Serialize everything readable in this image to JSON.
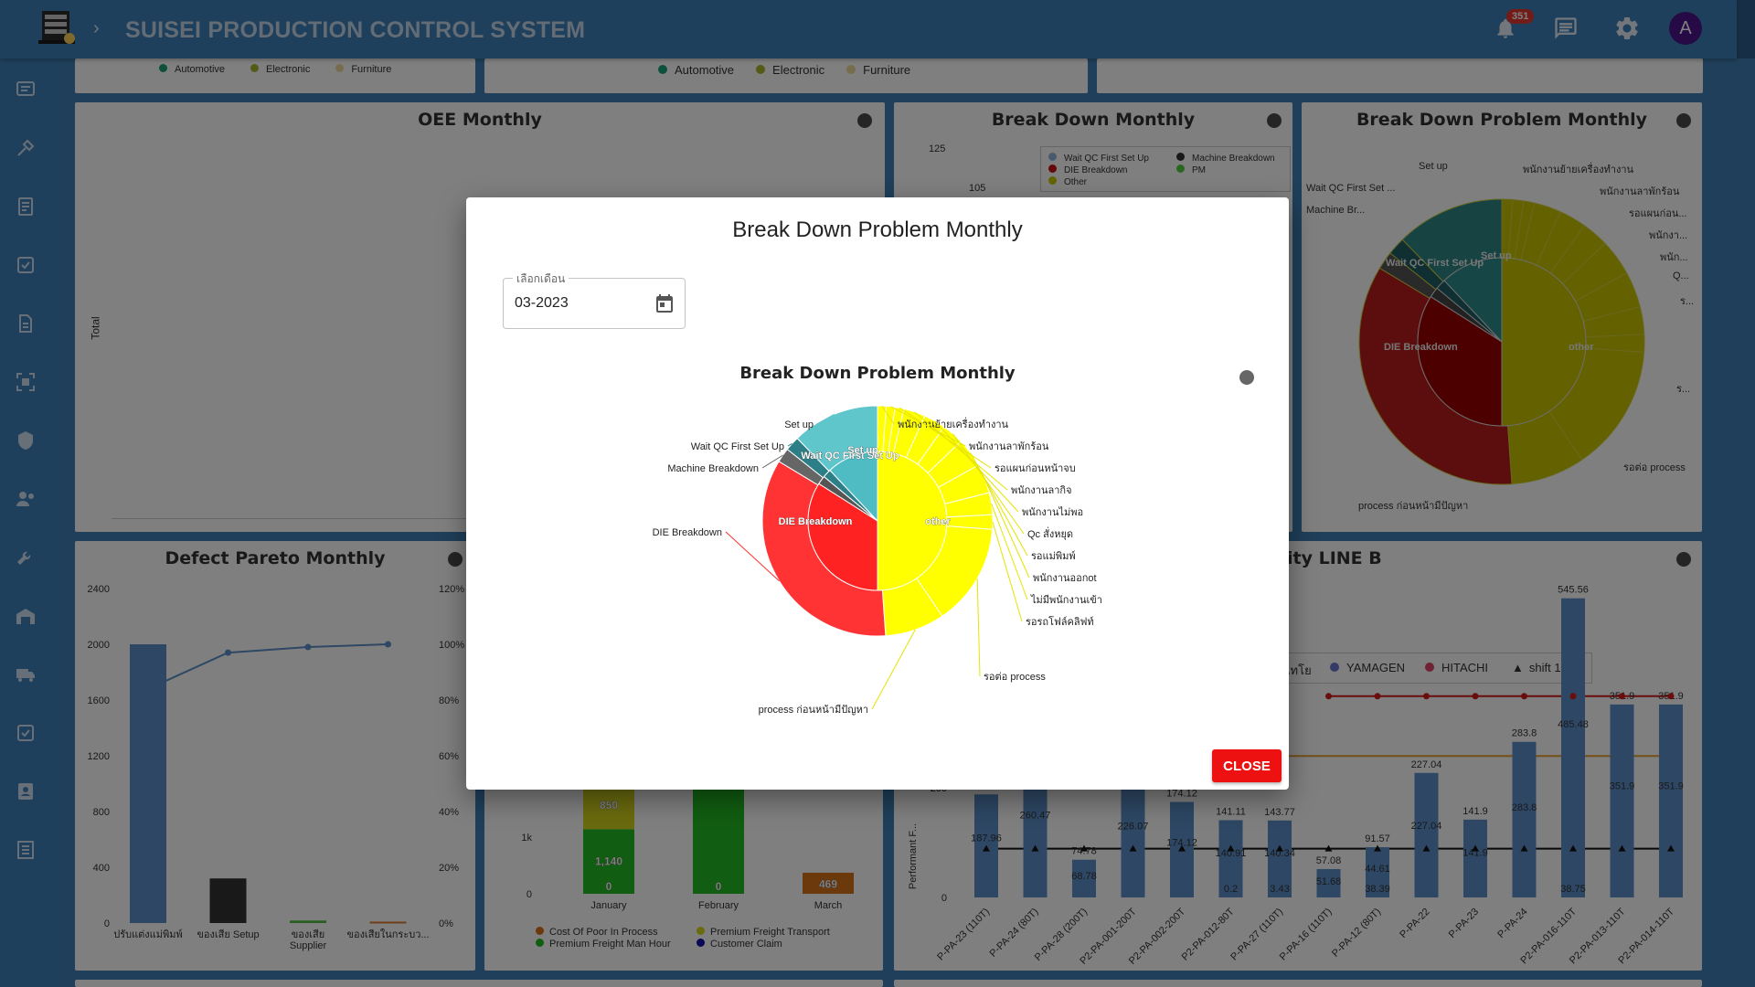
{
  "app": {
    "title": "SUISEI PRODUCTION CONTROL SYSTEM",
    "notification_count": "351",
    "avatar_initial": "A"
  },
  "top_legends": {
    "left": [
      "Automotive",
      "Electronic",
      "Furniture"
    ],
    "middle": [
      "Automotive",
      "Electronic",
      "Furniture"
    ],
    "colors": [
      "#1aa37a",
      "#a8b62c",
      "#eadb9a"
    ]
  },
  "panels": {
    "oee": {
      "title": "OEE Monthly",
      "ylabel": "Total"
    },
    "breakdown": {
      "title": "Break Down Monthly",
      "y_ticks": [
        "125",
        "105"
      ],
      "legend": [
        {
          "label": "Wait QC First Set Up",
          "color": "#8fb4dc"
        },
        {
          "label": "Machine Breakdown",
          "color": "#333333"
        },
        {
          "label": "DIE Breakdown",
          "color": "#cc1111"
        },
        {
          "label": "PM",
          "color": "#55cc44"
        },
        {
          "label": "Other",
          "color": "#c8c800"
        }
      ]
    },
    "bd_problem_bg": {
      "title": "Break Down Problem Monthly",
      "labels_left": [
        "Set up",
        "Wait QC First Set ...",
        "Machine Br..."
      ],
      "labels_right": [
        "พนักงานย้ายเครื่องทำงาน",
        "พนักงานลาพักร้อน",
        "รอแผนก่อน...",
        "พนักงา...",
        "พนัก...",
        "Q...",
        "ร...",
        "ร..."
      ],
      "inner_labels": [
        "Wait QC First Set Up",
        "Set up",
        "DIE Breakdown",
        "other"
      ],
      "bottom_labels": [
        "รอต่อ process",
        "process ก่อนหน้ามีปัญหา"
      ]
    },
    "defect": {
      "title": "Defect Pareto Monthly",
      "y_ticks": [
        "2400",
        "2000",
        "1600",
        "1200",
        "800",
        "400",
        "0"
      ],
      "y2_ticks": [
        "120%",
        "100%",
        "80%",
        "60%",
        "40%",
        "20%",
        "0%"
      ],
      "categories": [
        "ปรับแต่งแม่พิมพ์",
        "ของเสีย Setup",
        "ของเสีย Supplier",
        "ของเสียในกระบว..."
      ],
      "values": [
        2000,
        320,
        18,
        10
      ],
      "cumulative": [
        84,
        97,
        99,
        100
      ]
    },
    "cost": {
      "y_ticks": [
        "2k",
        "1k",
        "0"
      ],
      "months": [
        "January",
        "February",
        "March"
      ],
      "bar_labels": [
        "850",
        "1,140",
        "0",
        "0",
        "469"
      ],
      "legend": [
        {
          "label": "Cost Of Poor In Process",
          "color": "#d9731a"
        },
        {
          "label": "Premium Freight Transport",
          "color": "#d4d41c"
        },
        {
          "label": "Premium Freight Man Hour",
          "color": "#22bb22"
        },
        {
          "label": "Customer Claim",
          "color": "#1111aa"
        }
      ]
    },
    "capacity": {
      "title": "ity LINE B",
      "ylabel": "Performant F...",
      "legend": [
        {
          "label": "ไทโย",
          "color": "#5588cc"
        },
        {
          "label": "YAMAGEN",
          "color": "#6677cc"
        },
        {
          "label": "HITACHI",
          "color": "#dd4466"
        },
        {
          "label": "shift 1",
          "color": "#111111"
        }
      ],
      "y_ticks": [
        "200",
        "0"
      ],
      "categories": [
        "P-PA-23 (110T)",
        "P-PA-24 (80T)",
        "P-PA-28 (200T)",
        "P2-PA-001-200T",
        "P2-PA-002-200T",
        "P2-PA-012-80T",
        "P-PA-27 (110T)",
        "P-PA-16 (110T)",
        "P-PA-12 (80T)",
        "P-PA-22",
        "P-PA-23",
        "P-PA-24",
        "P2-PA-016-110T",
        "P2-PA-013-110T",
        "P2-PA-014-110T"
      ],
      "values": [
        187.96,
        260.47,
        68.78,
        226.07,
        174.12,
        140.91,
        140.34,
        51.68,
        91.57,
        227.04,
        141.9,
        283.8,
        545.56,
        351.9,
        351.9
      ],
      "top_labels": [
        "187.96",
        "260.47",
        "74.78",
        "226.07",
        "174.12",
        "141.11",
        "143.77",
        "57.08",
        "91.57",
        "227.04",
        "141.9",
        "283.8",
        "545.56",
        "351.9",
        "351.9"
      ],
      "mid_labels": [
        "187.96",
        "260.47",
        "68.78",
        "226.07",
        "174.12",
        "140.91",
        "140.34",
        "51.68",
        "44.61",
        "227.04",
        "141.9",
        "283.8",
        "485.48",
        "351.9",
        "351.9"
      ],
      "extra_labels": [
        "0.2",
        "3.43",
        "38.39",
        "38.75"
      ]
    }
  },
  "dialog": {
    "title": "Break Down Problem Monthly",
    "month_label": "เลือกเดือน",
    "month_value": "03-2023",
    "chart_title": "Break Down Problem Monthly",
    "close_label": "CLOSE"
  },
  "chart_data": {
    "type": "pie",
    "title": "Break Down Problem Monthly",
    "inner": [
      {
        "name": "other",
        "value": 50,
        "color": "#ffff00"
      },
      {
        "name": "DIE Breakdown",
        "value": 34,
        "color": "#ff2222"
      },
      {
        "name": "Machine Breakdown",
        "value": 2,
        "color": "#555555"
      },
      {
        "name": "Wait QC First Set Up",
        "value": 2,
        "color": "#2c7f86"
      },
      {
        "name": "Set up",
        "value": 12,
        "color": "#4fbcc4"
      }
    ],
    "outer": [
      {
        "name": "พนักงานย้ายเครื่องทำงาน",
        "value": 1.2,
        "color": "#ffff00"
      },
      {
        "name": "พนักงานลาพักร้อน",
        "value": 1.2,
        "color": "#ffff00"
      },
      {
        "name": "รอแผนก่อนหน้าจบ",
        "value": 1.2,
        "color": "#ffff00"
      },
      {
        "name": "พนักงานลากิจ",
        "value": 3,
        "color": "#ffff00"
      },
      {
        "name": "พนักงานไม่พอ",
        "value": 3,
        "color": "#ffff00"
      },
      {
        "name": "Qc สั่งหยุด",
        "value": 3,
        "color": "#ffff00"
      },
      {
        "name": "รอแม่พิมพ์",
        "value": 4,
        "color": "#ffff00"
      },
      {
        "name": "พนักงานออกot",
        "value": 4,
        "color": "#ffff00"
      },
      {
        "name": "ไม่มีพนักงานเข้า",
        "value": 3,
        "color": "#ffff00"
      },
      {
        "name": "รอรถโฟล์คลิฟท์",
        "value": 2,
        "color": "#ffff00"
      },
      {
        "name": "รอต่อ process",
        "value": 14,
        "color": "#ffff00"
      },
      {
        "name": "process ก่อนหน้ามีปัญหา",
        "value": 8.2,
        "color": "#ffff00"
      },
      {
        "name": "DIE Breakdown",
        "value": 34,
        "color": "#ff3333"
      },
      {
        "name": "Machine Breakdown",
        "value": 2,
        "color": "#666666"
      },
      {
        "name": "Wait QC First Set Up",
        "value": 2,
        "color": "#2c7f86"
      },
      {
        "name": "Set up",
        "value": 12,
        "color": "#5fc6cc"
      }
    ]
  }
}
